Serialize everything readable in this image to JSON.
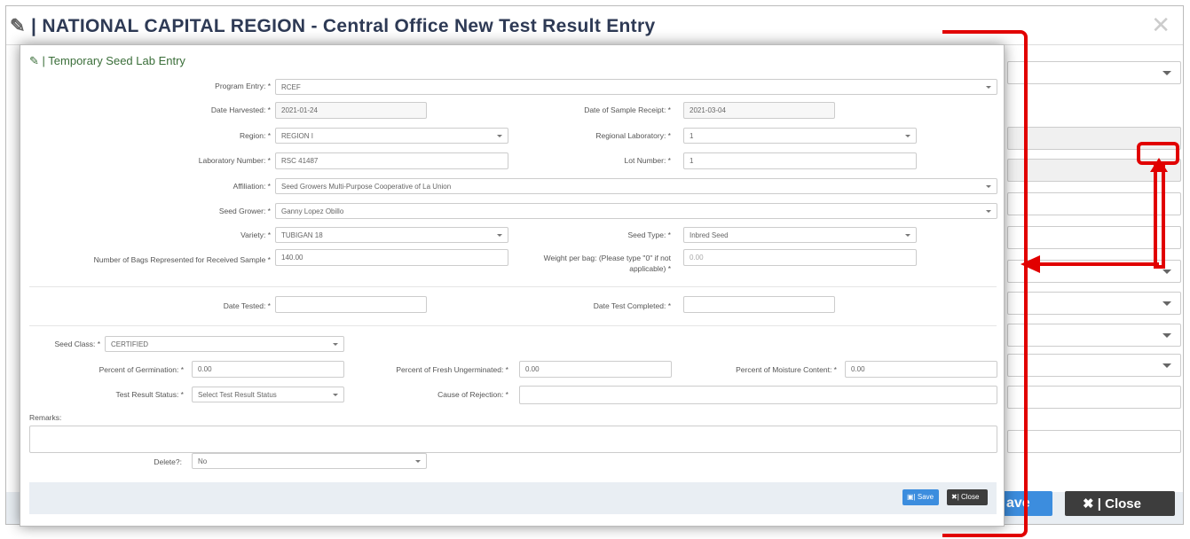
{
  "background_dialog": {
    "title": "| NATIONAL CAPITAL REGION - Central Office New Test Result Entry",
    "save_label": "ave",
    "close_label": "| Close"
  },
  "modal": {
    "title": "| Temporary Seed Lab Entry",
    "program_entry": {
      "label": "Program Entry: *",
      "value": "RCEF"
    },
    "date_harvested": {
      "label": "Date Harvested: *",
      "value": "2021-01-24"
    },
    "date_of_sample_receipt": {
      "label": "Date of Sample Receipt: *",
      "value": "2021-03-04"
    },
    "region": {
      "label": "Region: *",
      "value": "REGION I"
    },
    "regional_laboratory": {
      "label": "Regional Laboratory: *",
      "value": "1"
    },
    "laboratory_number": {
      "label": "Laboratory Number: *",
      "value": "RSC 41487"
    },
    "lot_number": {
      "label": "Lot Number: *",
      "value": "1"
    },
    "affiliation": {
      "label": "Affiliation: *",
      "value": "Seed Growers Multi-Purpose Cooperative of La Union"
    },
    "seed_grower": {
      "label": "Seed Grower: *",
      "value": "Ganny Lopez Obillo"
    },
    "variety": {
      "label": "Variety: *",
      "value": "TUBIGAN 18"
    },
    "seed_type": {
      "label": "Seed Type: *",
      "value": "Inbred Seed"
    },
    "bags": {
      "label": "Number of Bags Represented for Received Sample *",
      "value": "140.00"
    },
    "weight_per_bag": {
      "label_line1": "Weight per bag: (Please type \"0\" if not",
      "label_line2": "applicable) *",
      "value": "0.00"
    },
    "date_tested": {
      "label": "Date Tested: *",
      "value": ""
    },
    "date_test_completed": {
      "label": "Date Test Completed: *",
      "value": ""
    },
    "seed_class": {
      "label": "Seed Class: *",
      "value": "CERTIFIED"
    },
    "germination": {
      "label": "Percent of Germination: *",
      "value": "0.00"
    },
    "fresh_ungerminated": {
      "label": "Percent of Fresh Ungerminated: *",
      "value": "0.00"
    },
    "moisture": {
      "label": "Percent of Moisture Content: *",
      "value": "0.00"
    },
    "test_result_status": {
      "label": "Test Result Status: *",
      "value": "Select Test Result Status"
    },
    "cause_of_rejection": {
      "label": "Cause of Rejection: *",
      "value": ""
    },
    "remarks": {
      "label": "Remarks:",
      "value": ""
    },
    "delete": {
      "label": "Delete?:",
      "value": "No"
    },
    "save_label": "| Save",
    "close_label": "| Close"
  },
  "colors": {
    "annotation": "#e10000",
    "save": "#3c8dde",
    "close": "#3d3d3d"
  }
}
